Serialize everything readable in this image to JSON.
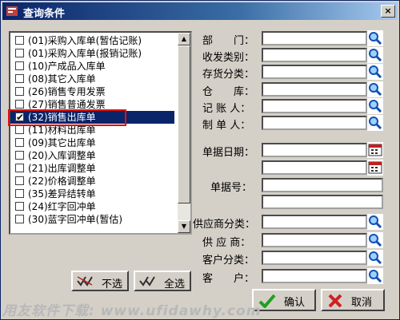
{
  "window": {
    "title": "查询条件",
    "close_label": "×"
  },
  "list": {
    "items": [
      {
        "label": "(01)采购入库单(暂估记账)",
        "checked": false,
        "selected": false
      },
      {
        "label": "(01)采购入库单(报销记账)",
        "checked": false,
        "selected": false
      },
      {
        "label": "(10)产成品入库单",
        "checked": false,
        "selected": false
      },
      {
        "label": "(08)其它入库单",
        "checked": false,
        "selected": false
      },
      {
        "label": "(26)销售专用发票",
        "checked": false,
        "selected": false
      },
      {
        "label": "(27)销售普通发票",
        "checked": false,
        "selected": false
      },
      {
        "label": "(32)销售出库单",
        "checked": true,
        "selected": true
      },
      {
        "label": "(11)材料出库单",
        "checked": false,
        "selected": false
      },
      {
        "label": "(09)其它出库单",
        "checked": false,
        "selected": false
      },
      {
        "label": "(20)入库调整单",
        "checked": false,
        "selected": false
      },
      {
        "label": "(21)出库调整单",
        "checked": false,
        "selected": false
      },
      {
        "label": "(22)价格调整单",
        "checked": false,
        "selected": false
      },
      {
        "label": "(35)差异结转单",
        "checked": false,
        "selected": false
      },
      {
        "label": "(24)红字回冲单",
        "checked": false,
        "selected": false
      },
      {
        "label": "(30)蓝字回冲单(暂估)",
        "checked": false,
        "selected": false
      }
    ]
  },
  "buttons": {
    "deselect_all": "不选",
    "select_all": "全选",
    "ok": "确认",
    "cancel": "取消"
  },
  "fields": {
    "department": "部　　门：",
    "send_receive_type": "收发类别：",
    "inventory_class": "存货分类：",
    "warehouse": "仓　　库：",
    "bookkeeper": "记 账 人：",
    "creator": "制 单 人：",
    "doc_date": "单据日期：",
    "doc_number": "单据号：",
    "supplier_class": "供应商分类：",
    "supplier": "供 应 商：",
    "customer_class": "客户分类：",
    "customer": "客　　户："
  },
  "watermark": "用友软件下载: www.ufidawhy.com",
  "colors": {
    "title_start": "#0a246a",
    "selection": "#0a246a",
    "highlight_box": "#e01010",
    "face": "#d4d0c8"
  },
  "icons": [
    "app-icon",
    "close-icon",
    "search-icon",
    "calendar-icon",
    "deselect-icon",
    "select-all-icon",
    "check-icon",
    "cancel-x-icon"
  ]
}
